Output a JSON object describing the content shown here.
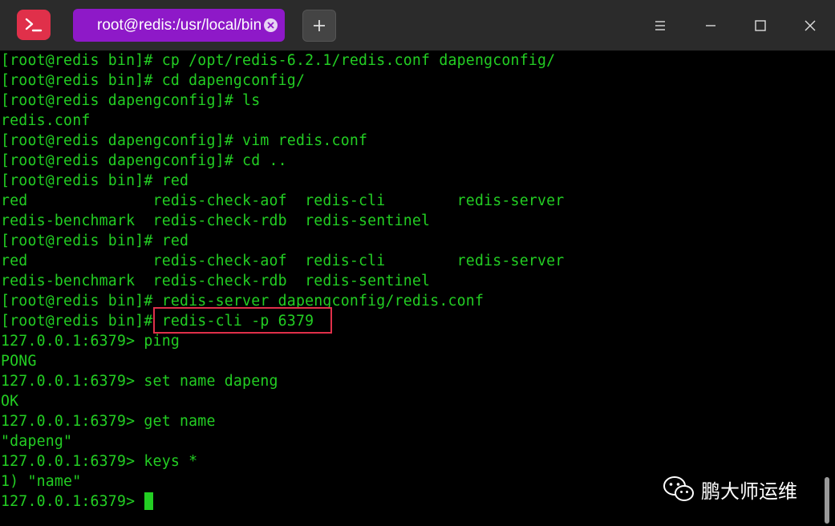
{
  "window": {
    "tab_title": "root@redis:/usr/local/bin",
    "new_tab_symbol": "+",
    "menu_symbol": "☰"
  },
  "colors": {
    "accent": "#8e19c8",
    "app_icon": "#e0304a",
    "terminal_text": "#23ce23",
    "highlight_border": "#e0304a"
  },
  "terminal": {
    "lines": [
      "[root@redis bin]# cp /opt/redis-6.2.1/redis.conf dapengconfig/",
      "[root@redis bin]# cd dapengconfig/",
      "[root@redis dapengconfig]# ls",
      "redis.conf",
      "[root@redis dapengconfig]# vim redis.conf",
      "[root@redis dapengconfig]# cd ..",
      "[root@redis bin]# red",
      "red              redis-check-aof  redis-cli        redis-server",
      "redis-benchmark  redis-check-rdb  redis-sentinel",
      "[root@redis bin]# red",
      "red              redis-check-aof  redis-cli        redis-server",
      "redis-benchmark  redis-check-rdb  redis-sentinel",
      "[root@redis bin]# redis-server dapengconfig/redis.conf",
      "[root@redis bin]# redis-cli -p 6379",
      "127.0.0.1:6379> ping",
      "PONG",
      "127.0.0.1:6379> set name dapeng",
      "OK",
      "127.0.0.1:6379> get name",
      "\"dapeng\"",
      "127.0.0.1:6379> keys *",
      "1) \"name\"",
      "127.0.0.1:6379> "
    ]
  },
  "watermark": {
    "text": "鹏大师运维",
    "icon": "wechat-icon"
  }
}
